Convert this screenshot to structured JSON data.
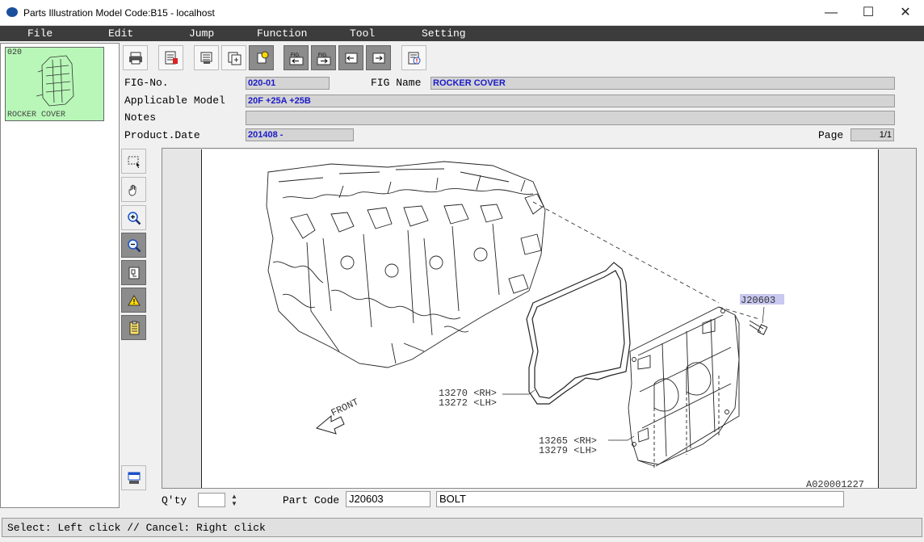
{
  "window": {
    "title": "Parts Illustration Model Code:B15 - localhost",
    "controls": {
      "minimize": "—",
      "maximize": "☐",
      "close": "✕"
    }
  },
  "menu": [
    "File",
    "Edit",
    "Jump",
    "Function",
    "Tool",
    "Setting"
  ],
  "thumbnail": {
    "fig_no": "020",
    "caption": "ROCKER COVER",
    "bg_color": "#b8f7b8"
  },
  "toolbar": {
    "fig_prev_label": "FIG.",
    "fig_next_label": "FIG.",
    "icons": [
      "print-icon",
      "report-icon",
      "search-parts-icon",
      "add-list-icon",
      "favorite-icon",
      "fig-prev-icon",
      "fig-next-icon",
      "page-prev-icon",
      "page-next-icon",
      "notice-icon"
    ]
  },
  "header": {
    "fig_no_label": "FIG-No.",
    "fig_no": "020-01",
    "fig_name_label": "FIG Name",
    "fig_name": "ROCKER COVER",
    "model_label": "Applicable Model",
    "model": "20F +25A +25B",
    "notes_label": "Notes",
    "notes": "",
    "date_label": "Product.Date",
    "date": "201408 -",
    "page_label": "Page",
    "page": "1/1"
  },
  "side_tools": [
    "select-area-icon",
    "pan-hand-icon",
    "zoom-in-icon",
    "zoom-out-icon",
    "fit-page-icon",
    "warning-icon",
    "note-icon",
    "print-view-icon"
  ],
  "drawing": {
    "callouts": {
      "bolt": "J20603",
      "gasket_rh": "13270 <RH>",
      "gasket_lh": "13272 <LH>",
      "cover_rh": "13265 <RH>",
      "cover_lh": "13279 <LH>",
      "front": "FRONT",
      "drawing_id": "A020001227"
    }
  },
  "bottom": {
    "qty_label": "Q'ty",
    "qty": "",
    "part_code_label": "Part Code",
    "part_code": "J20603",
    "part_name": "BOLT"
  },
  "status": "Select: Left click // Cancel: Right click",
  "colors": {
    "menubar": "#3c3c3c",
    "field_text": "#1a1ac8",
    "highlight": "#c8c8f0"
  }
}
